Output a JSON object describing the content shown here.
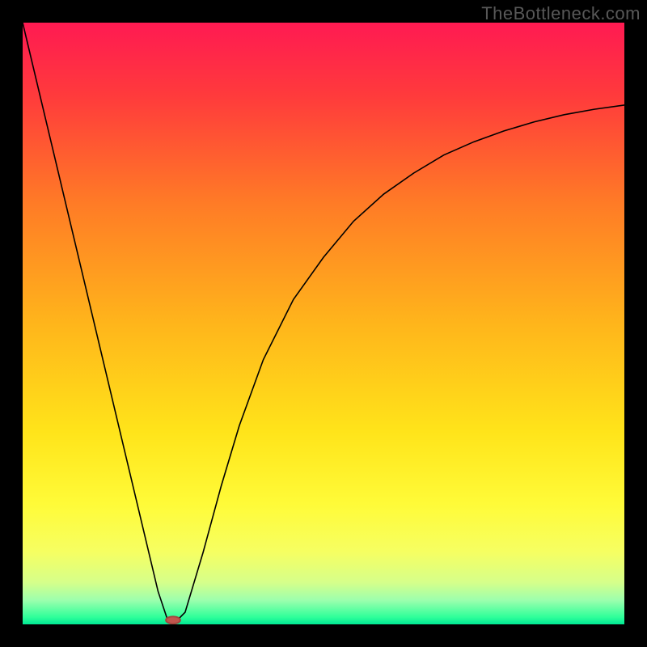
{
  "watermark": "TheBottleneck.com",
  "chart_data": {
    "type": "line",
    "title": "",
    "xlabel": "",
    "ylabel": "",
    "xlim": [
      0,
      100
    ],
    "ylim": [
      0,
      100
    ],
    "grid": false,
    "series": [
      {
        "name": "curve",
        "x": [
          0,
          5,
          10,
          15,
          20,
          22.5,
          24,
          25,
          27,
          30,
          33,
          36,
          40,
          45,
          50,
          55,
          60,
          65,
          70,
          75,
          80,
          85,
          90,
          95,
          100
        ],
        "y": [
          100,
          79,
          58,
          37,
          16,
          5.5,
          1,
          0,
          2,
          12,
          23,
          33,
          44,
          54,
          61,
          67,
          71.5,
          75,
          78,
          80.2,
          82,
          83.5,
          84.7,
          85.6,
          86.3
        ]
      }
    ],
    "marker": {
      "x": 25,
      "y": 0.7
    },
    "background_gradient": {
      "stops": [
        {
          "pct": 0,
          "color": "#ff1a52"
        },
        {
          "pct": 12,
          "color": "#ff3a3c"
        },
        {
          "pct": 30,
          "color": "#ff7b26"
        },
        {
          "pct": 50,
          "color": "#ffb51b"
        },
        {
          "pct": 68,
          "color": "#ffe41a"
        },
        {
          "pct": 80,
          "color": "#fffb38"
        },
        {
          "pct": 88,
          "color": "#f6ff62"
        },
        {
          "pct": 93,
          "color": "#d6ff8a"
        },
        {
          "pct": 96,
          "color": "#9cffad"
        },
        {
          "pct": 98.8,
          "color": "#2fff9a"
        },
        {
          "pct": 100,
          "color": "#00e893"
        }
      ]
    },
    "colors": {
      "curve": "#000000",
      "marker_fill": "#c1564e",
      "marker_stroke": "#a3463f"
    }
  }
}
